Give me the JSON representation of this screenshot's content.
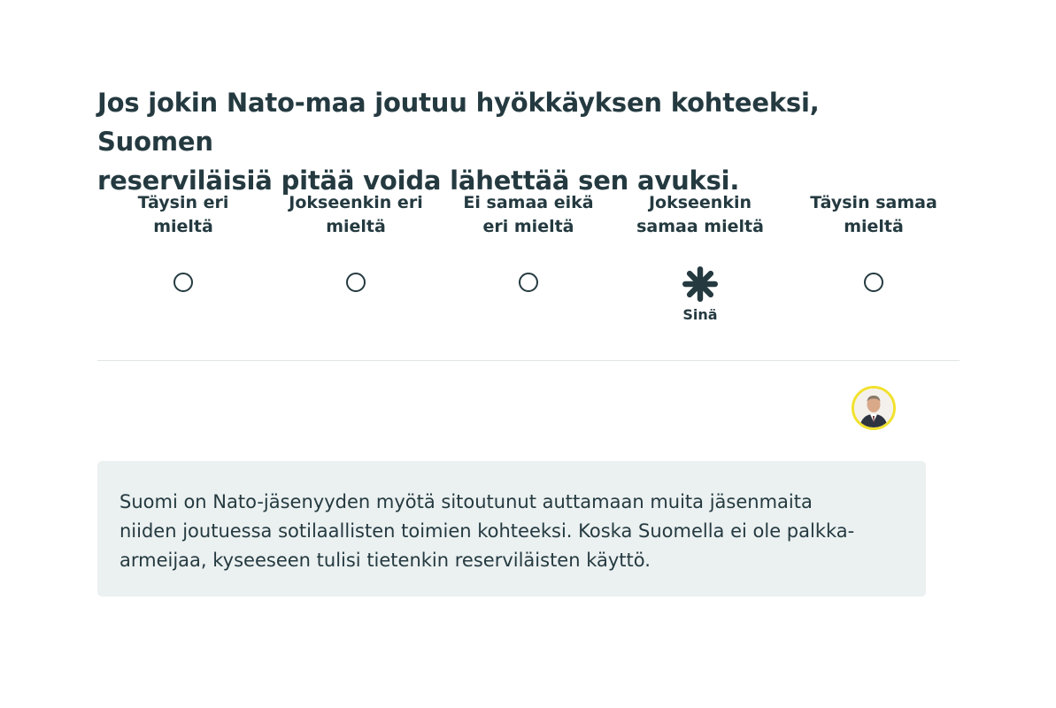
{
  "question": {
    "line1": "Jos jokin Nato-maa joutuu hyökkäyksen kohteeksi, Suomen",
    "line2": "reserviläisiä pitää voida lähettää sen avuksi."
  },
  "scale": {
    "options": [
      {
        "line1": "Täysin eri",
        "line2": "mieltä",
        "selected": false
      },
      {
        "line1": "Jokseenkin eri",
        "line2": "mieltä",
        "selected": false
      },
      {
        "line1": "Ei samaa eikä",
        "line2": "eri mieltä",
        "selected": false
      },
      {
        "line1": "Jokseenkin",
        "line2": "samaa mieltä",
        "selected": true
      },
      {
        "line1": "Täysin samaa",
        "line2": "mieltä",
        "selected": false
      }
    ],
    "you_label": "Sinä"
  },
  "colors": {
    "text": "#243a40",
    "avatar_ring": "#f2e12e",
    "info_bg": "#ebf0f0",
    "divider": "#dfe4e4"
  },
  "answer": {
    "line1": "Suomi on Nato-jäsenyyden myötä sitoutunut auttamaan muita jäsenmaita",
    "line2": "niiden joutuessa sotilaallisten toimien kohteeksi. Koska Suomella ei ole palkka-",
    "line3": "armeijaa, kyseeseen tulisi tietenkin reserviläisten käyttö."
  }
}
